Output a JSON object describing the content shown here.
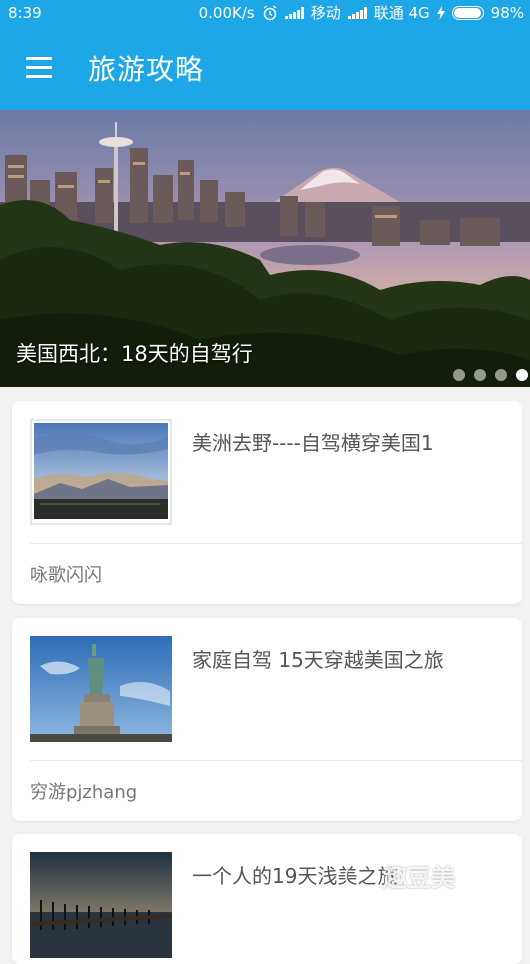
{
  "status_bar": {
    "time": "8:39",
    "speed": "0.00K/s",
    "carrier1": "移动",
    "carrier2": "联通 4G",
    "battery": "98%",
    "battery_level": 0.98,
    "icons": [
      "alarm-clock-icon",
      "signal-icon",
      "charging-icon",
      "battery-icon"
    ]
  },
  "app_bar": {
    "title": "旅游攻略",
    "menu_icon": "hamburger-menu-icon"
  },
  "banner": {
    "caption": "美国西北：18天的自驾行",
    "page_count": 4,
    "active_page": 4
  },
  "articles": [
    {
      "title": "美洲去野----自驾横穿美国1",
      "author": "咏歌闪闪",
      "thumb": "mountain-sunset-photo"
    },
    {
      "title": "家庭自驾 15天穿越美国之旅",
      "author": "穷游pjzhang",
      "thumb": "statue-of-liberty-photo"
    },
    {
      "title": "一个人的19天浅美之旅",
      "author": "",
      "thumb": "pier-sunset-photo"
    }
  ],
  "watermark": "趣豆美",
  "colors": {
    "primary": "#1ea7e6",
    "background": "#f2f2f2",
    "card": "#ffffff"
  }
}
